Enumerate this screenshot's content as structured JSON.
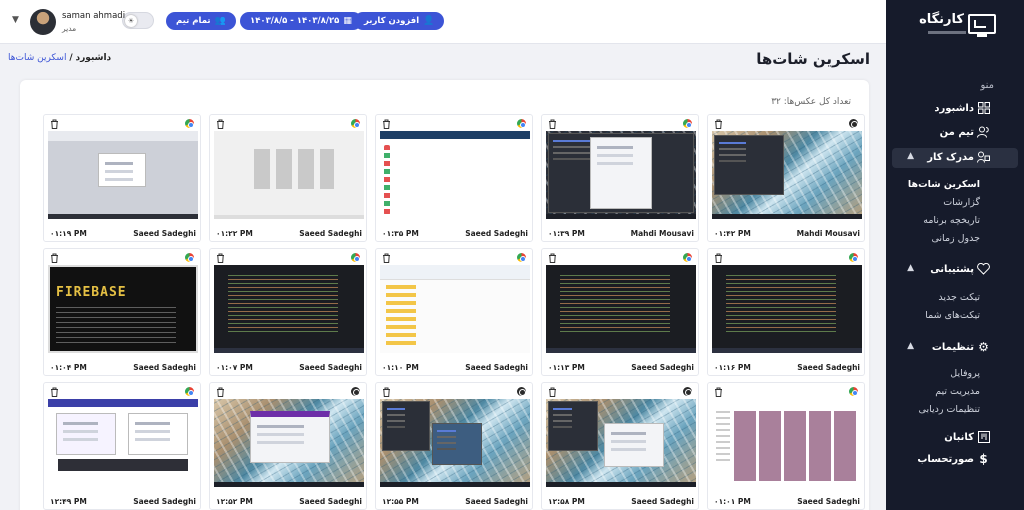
{
  "sidebar": {
    "logo_text": "کارنگاه",
    "menu_title": "منو",
    "items": [
      {
        "label": "داشبورد",
        "icon": "dashboard-grid-icon"
      },
      {
        "label": "تیم من",
        "icon": "team-users-icon"
      },
      {
        "label": "مدرک کار",
        "icon": "work-evidence-icon"
      },
      {
        "label": "پشتیبانی",
        "icon": "support-heart-icon"
      },
      {
        "label": "تنظیمات",
        "icon": "settings-gear-icon"
      },
      {
        "label": "کانبان",
        "icon": "kanban-board-icon"
      },
      {
        "label": "صورتحساب",
        "icon": "billing-dollar-icon"
      }
    ],
    "work_sub": [
      "اسکرین شات‌ها",
      "گزارشات",
      "تاریخچه برنامه",
      "جدول زمانی"
    ],
    "support_sub": [
      "تیکت جدید",
      "تیکت‌های شما"
    ],
    "settings_sub": [
      "پروفایل",
      "مدیریت تیم",
      "تنظیمات ردیابی"
    ]
  },
  "topbar": {
    "add_user": "افزودن کاربر",
    "date_range": "۱۴۰۳/۸/۲۵ - ۱۴۰۳/۸/۵",
    "whole_team": "تمام تیم",
    "user_name": "saman ahmadi",
    "user_role": "مدیر"
  },
  "page": {
    "title": "اسکرین شات‌ها",
    "breadcrumb_home": "داشبورد",
    "breadcrumb_sep": "/",
    "breadcrumb_current": "اسکرین شات‌ها",
    "count_label": "تعداد کل عکس‌ها: ۳۲"
  },
  "screenshots": [
    {
      "user": "Mahdi Mousavi",
      "time": "۰۱:۴۲ PM",
      "browser": "dark-browser-icon",
      "theme": "aerial-dark-window"
    },
    {
      "user": "Mahdi Mousavi",
      "time": "۰۱:۳۹ PM",
      "browser": "chrome-icon",
      "theme": "dark-app-dialog"
    },
    {
      "user": "Saeed Sadeghi",
      "time": "۰۱:۳۵ PM",
      "browser": "chrome-icon",
      "theme": "whatsapp-web"
    },
    {
      "user": "Saeed Sadeghi",
      "time": "۰۱:۲۲ PM",
      "browser": "chrome-icon",
      "theme": "figma-design"
    },
    {
      "user": "Saeed Sadeghi",
      "time": "۰۱:۱۹ PM",
      "browser": "chrome-icon",
      "theme": "dashboard-modal"
    },
    {
      "user": "Saeed Sadeghi",
      "time": "۰۱:۱۶ PM",
      "browser": "chrome-icon",
      "theme": "code-editor"
    },
    {
      "user": "Saeed Sadeghi",
      "time": "۰۱:۱۳ PM",
      "browser": "chrome-icon",
      "theme": "code-editor"
    },
    {
      "user": "Saeed Sadeghi",
      "time": "۰۱:۱۰ PM",
      "browser": "chrome-icon",
      "theme": "file-explorer"
    },
    {
      "user": "Saeed Sadeghi",
      "time": "۰۱:۰۷ PM",
      "browser": "chrome-icon",
      "theme": "code-editor"
    },
    {
      "user": "Saeed Sadeghi",
      "time": "۰۱:۰۴ PM",
      "browser": "chrome-icon",
      "theme": "terminal-firebase"
    },
    {
      "user": "Saeed Sadeghi",
      "time": "۰۱:۰۱ PM",
      "browser": "chrome-icon",
      "theme": "youtube-grid"
    },
    {
      "user": "Saeed Sadeghi",
      "time": "۱۲:۵۸ PM",
      "browser": "dark-browser-icon",
      "theme": "aerial-windows"
    },
    {
      "user": "Saeed Sadeghi",
      "time": "۱۲:۵۵ PM",
      "browser": "dark-browser-icon",
      "theme": "aerial-windows-2"
    },
    {
      "user": "Saeed Sadeghi",
      "time": "۱۲:۵۲ PM",
      "browser": "dark-browser-icon",
      "theme": "aerial-purple-window"
    },
    {
      "user": "Saeed Sadeghi",
      "time": "۱۲:۴۹ PM",
      "browser": "chrome-icon",
      "theme": "webpage-signup"
    }
  ],
  "colors": {
    "primary": "#3c54d6",
    "sidebar_bg": "#161b2b",
    "page_bg": "#f1f2f6"
  }
}
